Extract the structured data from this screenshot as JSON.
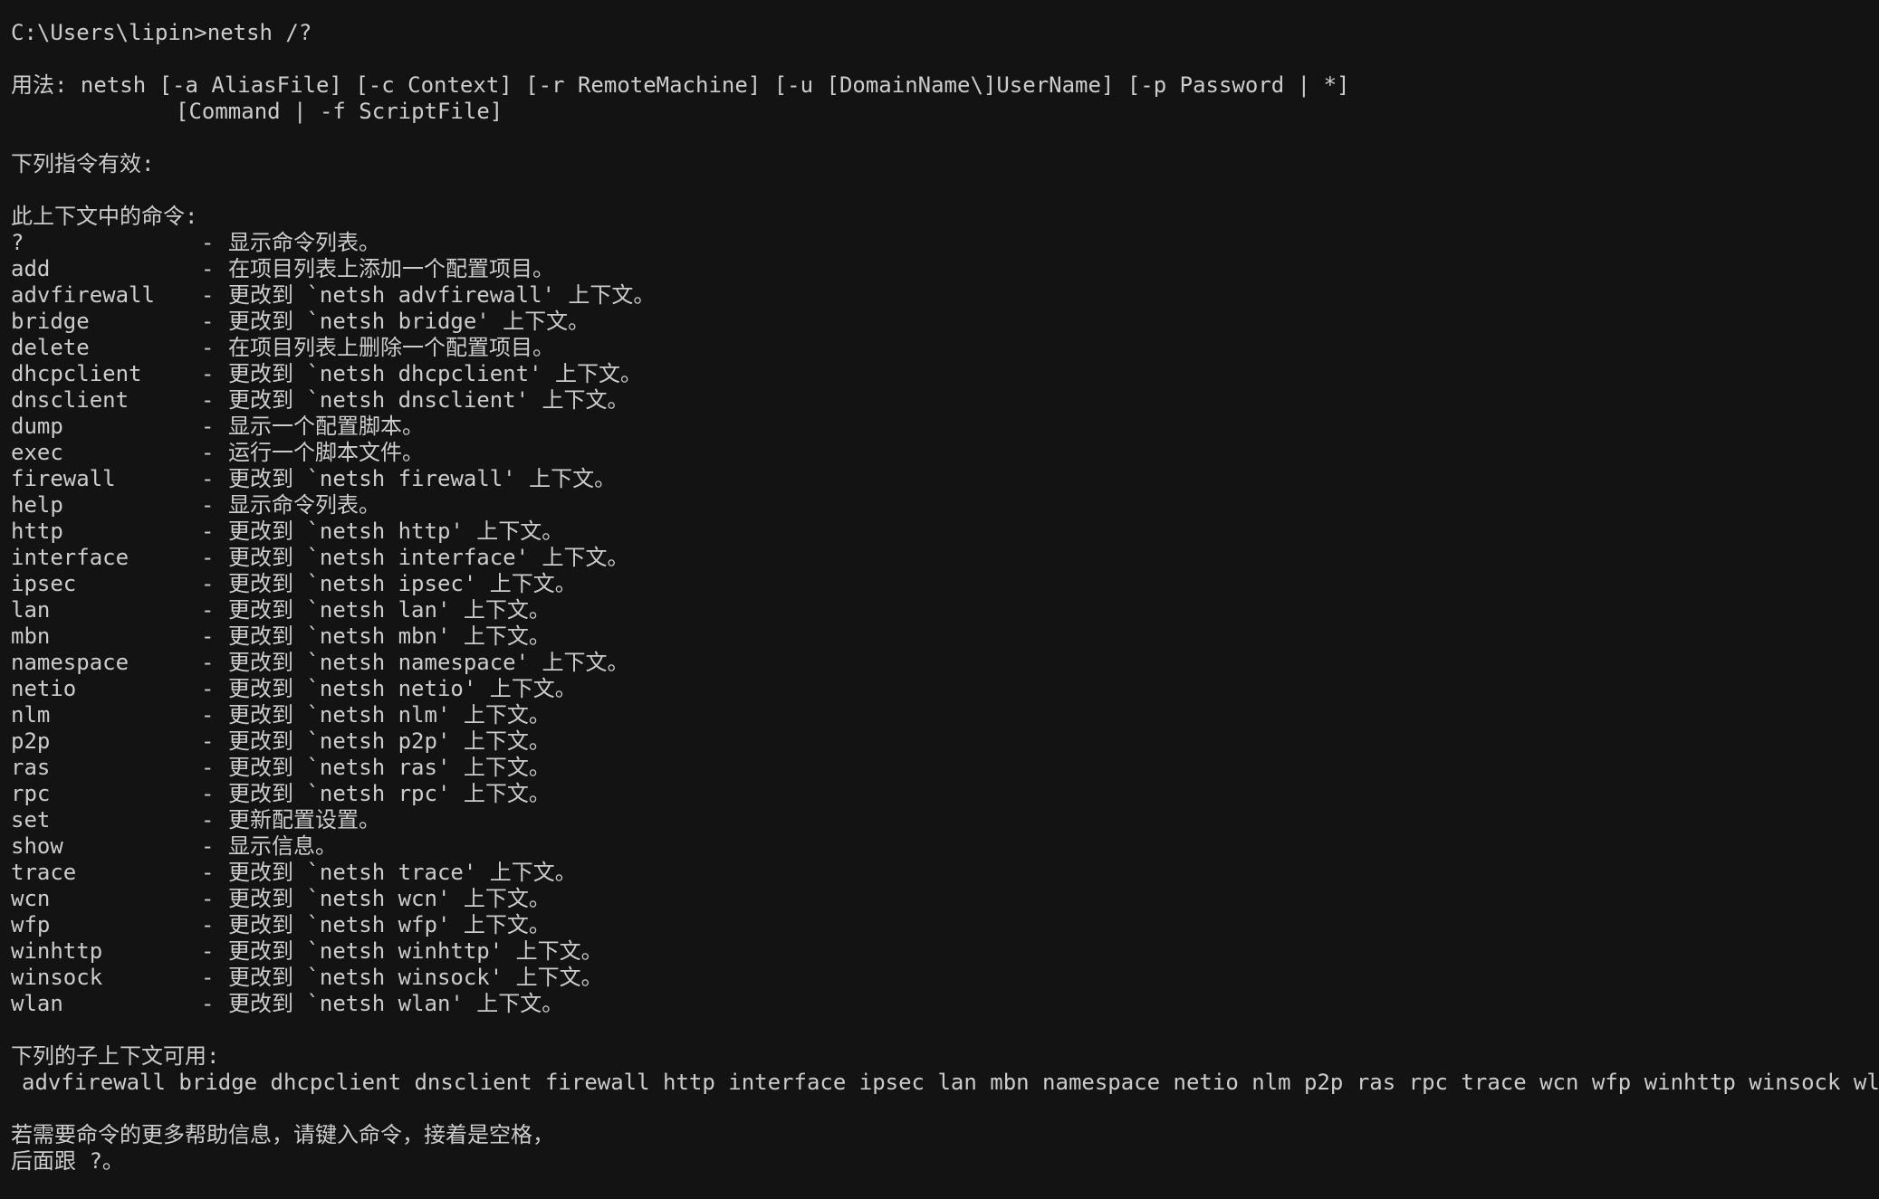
{
  "terminal": {
    "prompt": "C:\\Users\\lipin>netsh /?",
    "usage_line_1": "用法: netsh [-a AliasFile] [-c Context] [-r RemoteMachine] [-u [DomainName\\]UserName] [-p Password | *]",
    "usage_line_2": "[Command | -f ScriptFile]",
    "valid_commands_heading": "下列指令有效:",
    "context_commands_heading": "此上下文中的命令:",
    "dash": "-",
    "commands": [
      {
        "name": "?",
        "description": "显示命令列表。"
      },
      {
        "name": "add",
        "description": "在项目列表上添加一个配置项目。"
      },
      {
        "name": "advfirewall",
        "description": "更改到 `netsh advfirewall' 上下文。"
      },
      {
        "name": "bridge",
        "description": "更改到 `netsh bridge' 上下文。"
      },
      {
        "name": "delete",
        "description": "在项目列表上删除一个配置项目。"
      },
      {
        "name": "dhcpclient",
        "description": "更改到 `netsh dhcpclient' 上下文。"
      },
      {
        "name": "dnsclient",
        "description": "更改到 `netsh dnsclient' 上下文。"
      },
      {
        "name": "dump",
        "description": "显示一个配置脚本。"
      },
      {
        "name": "exec",
        "description": "运行一个脚本文件。"
      },
      {
        "name": "firewall",
        "description": "更改到 `netsh firewall' 上下文。"
      },
      {
        "name": "help",
        "description": "显示命令列表。"
      },
      {
        "name": "http",
        "description": "更改到 `netsh http' 上下文。"
      },
      {
        "name": "interface",
        "description": "更改到 `netsh interface' 上下文。"
      },
      {
        "name": "ipsec",
        "description": "更改到 `netsh ipsec' 上下文。"
      },
      {
        "name": "lan",
        "description": "更改到 `netsh lan' 上下文。"
      },
      {
        "name": "mbn",
        "description": "更改到 `netsh mbn' 上下文。"
      },
      {
        "name": "namespace",
        "description": "更改到 `netsh namespace' 上下文。"
      },
      {
        "name": "netio",
        "description": "更改到 `netsh netio' 上下文。"
      },
      {
        "name": "nlm",
        "description": "更改到 `netsh nlm' 上下文。"
      },
      {
        "name": "p2p",
        "description": "更改到 `netsh p2p' 上下文。"
      },
      {
        "name": "ras",
        "description": "更改到 `netsh ras' 上下文。"
      },
      {
        "name": "rpc",
        "description": "更改到 `netsh rpc' 上下文。"
      },
      {
        "name": "set",
        "description": "更新配置设置。"
      },
      {
        "name": "show",
        "description": "显示信息。"
      },
      {
        "name": "trace",
        "description": "更改到 `netsh trace' 上下文。"
      },
      {
        "name": "wcn",
        "description": "更改到 `netsh wcn' 上下文。"
      },
      {
        "name": "wfp",
        "description": "更改到 `netsh wfp' 上下文。"
      },
      {
        "name": "winhttp",
        "description": "更改到 `netsh winhttp' 上下文。"
      },
      {
        "name": "winsock",
        "description": "更改到 `netsh winsock' 上下文。"
      },
      {
        "name": "wlan",
        "description": "更改到 `netsh wlan' 上下文。"
      }
    ],
    "subcontexts_heading": "下列的子上下文可用:",
    "subcontexts": "advfirewall bridge dhcpclient dnsclient firewall http interface ipsec lan mbn namespace netio nlm p2p ras rpc trace wcn wfp winhttp winsock wlan",
    "help_hint_line_1": "若需要命令的更多帮助信息，请键入命令，接着是空格，",
    "help_hint_line_2": "后面跟 ?。"
  },
  "colors": {
    "background": "#131313",
    "foreground": "#cccccc"
  }
}
